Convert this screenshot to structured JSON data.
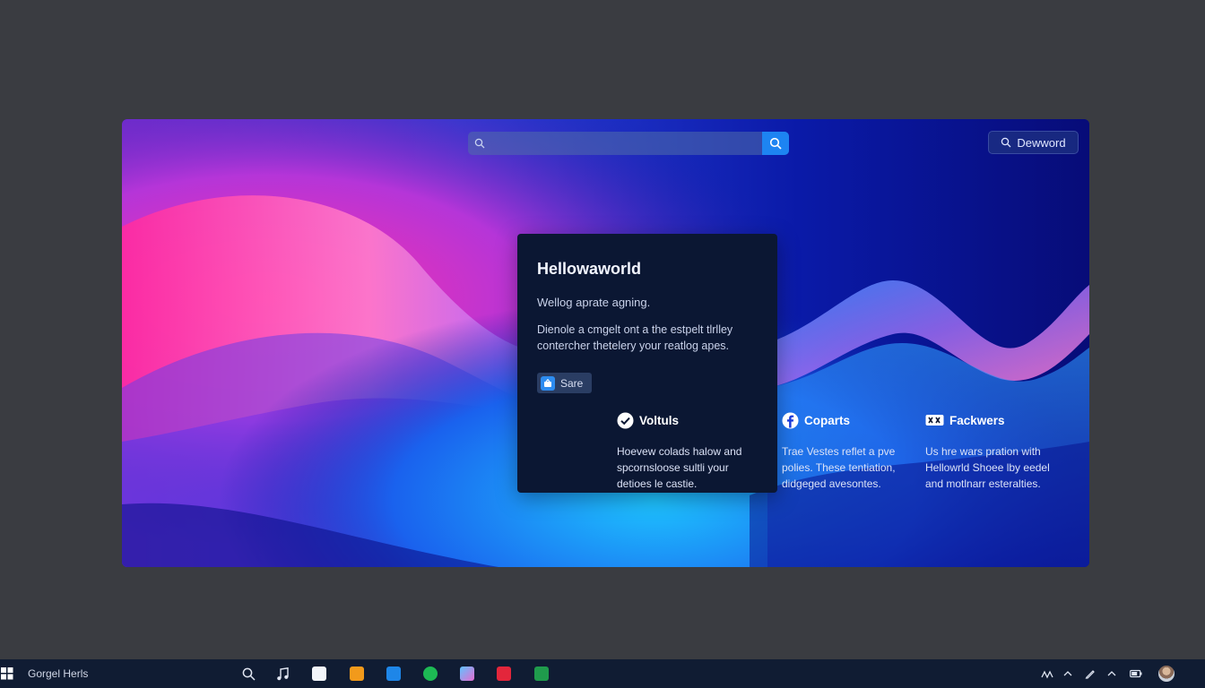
{
  "window": {
    "search": {
      "value": "",
      "placeholder": ""
    },
    "download_label": "Dewword"
  },
  "card": {
    "title": "Hellowaworld",
    "subtitle": "Wellog aprate agning.",
    "body": "Dienole a cmgelt ont a the estpelt tlrlley contercher thetelery your reatlog apes.",
    "share_label": "Sare"
  },
  "features": [
    {
      "title": "Voltuls",
      "body": "Hoevew colads halow and spcornsloose sultli your detioes le castie."
    },
    {
      "title": "Coparts",
      "body": "Trae Vestes reflet a pve polies. These tentiation, didgeged avesontes."
    },
    {
      "title": "Fackwers",
      "body": "Us hre wars pration with Hellowrld Shoee lby eedel and motlnarr esteralties."
    }
  ],
  "taskbar": {
    "app_label": "Gorgel Herls",
    "colors": {
      "bar": "#101c33",
      "accent": "#1d84f2"
    }
  }
}
